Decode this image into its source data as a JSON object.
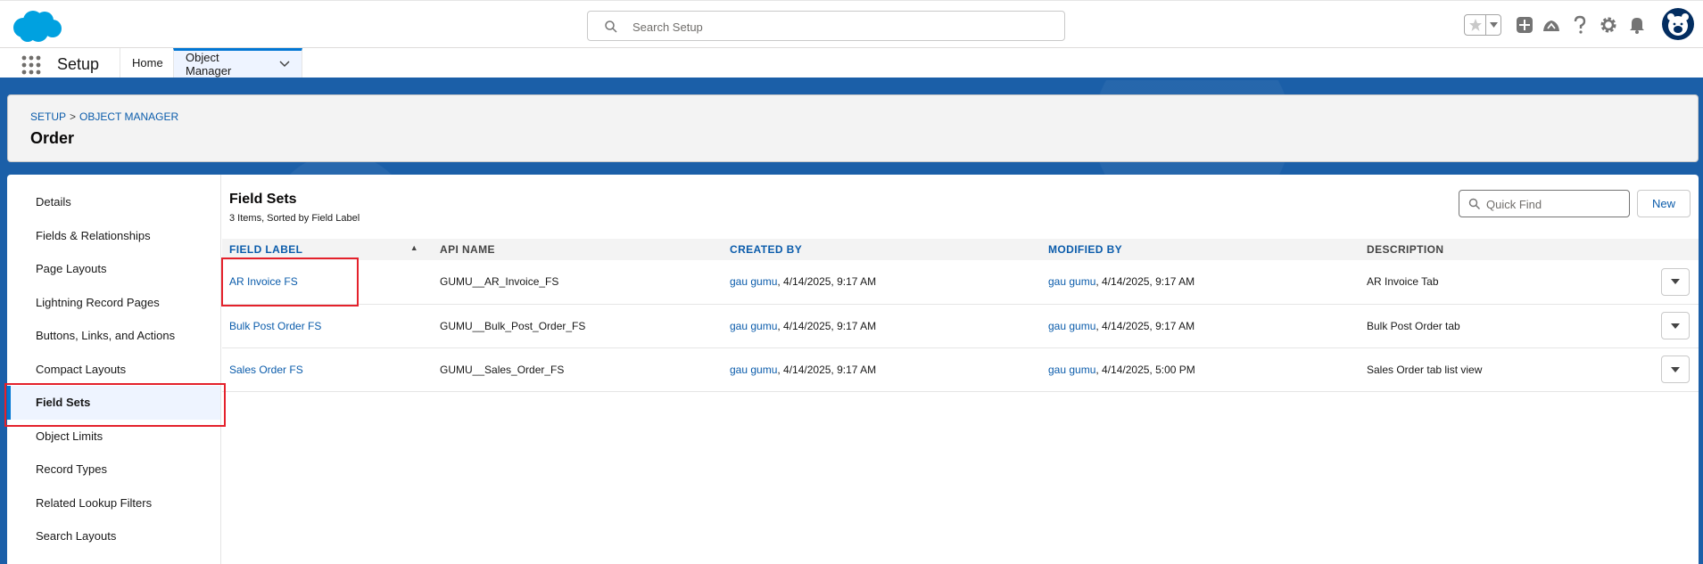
{
  "global_header": {
    "search_placeholder": "Search Setup"
  },
  "context_bar": {
    "app_name": "Setup",
    "tabs": [
      {
        "label": "Home"
      },
      {
        "label": "Object Manager"
      }
    ]
  },
  "page_header": {
    "breadcrumb": [
      "SETUP",
      "OBJECT MANAGER"
    ],
    "breadcrumb_sep": ">",
    "title": "Order"
  },
  "sidebar": {
    "items": [
      {
        "label": "Details"
      },
      {
        "label": "Fields & Relationships"
      },
      {
        "label": "Page Layouts"
      },
      {
        "label": "Lightning Record Pages"
      },
      {
        "label": "Buttons, Links, and Actions"
      },
      {
        "label": "Compact Layouts"
      },
      {
        "label": "Field Sets"
      },
      {
        "label": "Object Limits"
      },
      {
        "label": "Record Types"
      },
      {
        "label": "Related Lookup Filters"
      },
      {
        "label": "Search Layouts"
      }
    ],
    "active": "Field Sets"
  },
  "content": {
    "title": "Field Sets",
    "subtitle": "3 Items, Sorted by Field Label",
    "quick_find_placeholder": "Quick Find",
    "new_label": "New",
    "columns": [
      "FIELD LABEL",
      "API NAME",
      "CREATED BY",
      "MODIFIED BY",
      "DESCRIPTION"
    ],
    "rows": [
      {
        "field_label": "AR Invoice FS",
        "api_name": "GUMU__AR_Invoice_FS",
        "created_user": "gau gumu",
        "created_date": ", 4/14/2025, 9:17 AM",
        "modified_user": "gau gumu",
        "modified_date": ", 4/14/2025, 9:17 AM",
        "description": "AR Invoice Tab"
      },
      {
        "field_label": "Bulk Post Order FS",
        "api_name": "GUMU__Bulk_Post_Order_FS",
        "created_user": "gau gumu",
        "created_date": ", 4/14/2025, 9:17 AM",
        "modified_user": "gau gumu",
        "modified_date": ", 4/14/2025, 9:17 AM",
        "description": "Bulk Post Order tab"
      },
      {
        "field_label": "Sales Order FS",
        "api_name": "GUMU__Sales_Order_FS",
        "created_user": "gau gumu",
        "created_date": ", 4/14/2025, 9:17 AM",
        "modified_user": "gau gumu",
        "modified_date": ", 4/14/2025, 5:00 PM",
        "description": "Sales Order tab list view"
      }
    ]
  },
  "colors": {
    "brand_blue": "#0176d3",
    "link_blue": "#0b5cab",
    "band_blue": "#1b5fa8",
    "highlight_red": "#e4212b"
  }
}
